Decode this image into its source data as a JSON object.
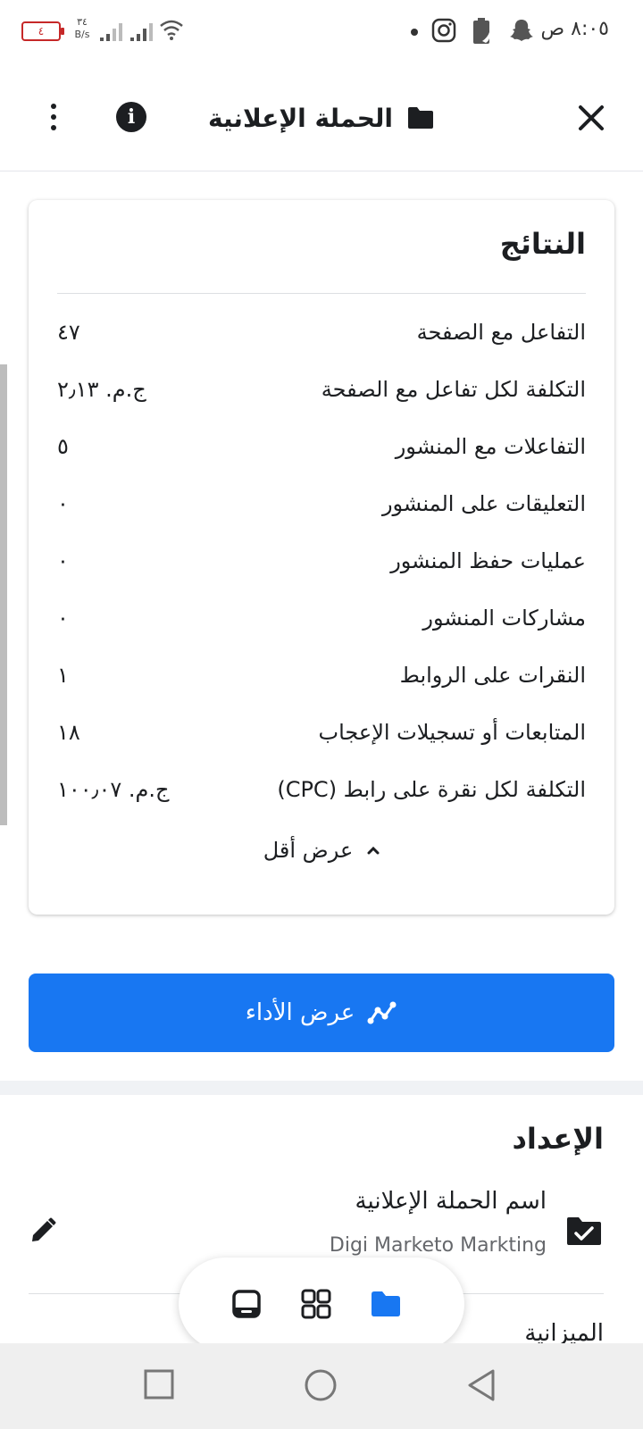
{
  "status_bar": {
    "time": "٨:٠٥ ص",
    "battery_level": "٤",
    "net_speed_value": "٣٤",
    "net_speed_unit": "B/s",
    "icons": [
      "snapchat-icon",
      "battery-saver-icon",
      "instagram-icon",
      "notification-dot",
      "wifi-icon",
      "signal-icon",
      "battery-icon"
    ]
  },
  "header": {
    "title": "الحملة الإعلانية",
    "icons": [
      "close-icon",
      "folder-icon",
      "info-icon",
      "more-vertical-icon"
    ]
  },
  "results": {
    "title": "النتائج",
    "rows": [
      {
        "label": "التفاعل مع الصفحة",
        "value": "٤٧"
      },
      {
        "label": "التكلفة لكل تفاعل مع الصفحة",
        "value": "ج.م. ٢٫١٣"
      },
      {
        "label": "التفاعلات مع المنشور",
        "value": "٥"
      },
      {
        "label": "التعليقات على المنشور",
        "value": "٠"
      },
      {
        "label": "عمليات حفظ المنشور",
        "value": "٠"
      },
      {
        "label": "مشاركات المنشور",
        "value": "٠"
      },
      {
        "label": "النقرات على الروابط",
        "value": "١"
      },
      {
        "label": "المتابعات أو تسجيلات الإعجاب",
        "value": "١٨"
      },
      {
        "label": "التكلفة لكل نقرة على رابط (CPC)",
        "value": "ج.م. ١٠٠٫٠٧"
      }
    ],
    "toggle_label": "عرض أقل"
  },
  "performance_button": {
    "label": "عرض الأداء"
  },
  "setup": {
    "title": "الإعداد",
    "campaign_name_label": "اسم الحملة الإعلانية",
    "campaign_name_value": "Digi Marketo Markting",
    "next_label": "الميزانية"
  },
  "tabs": [
    "ads-manager-icon",
    "grid-icon",
    "folder-icon"
  ],
  "colors": {
    "primary": "#1877f2",
    "text": "#1c1e21",
    "secondary_text": "#65676b",
    "battery_low": "#c62828"
  }
}
